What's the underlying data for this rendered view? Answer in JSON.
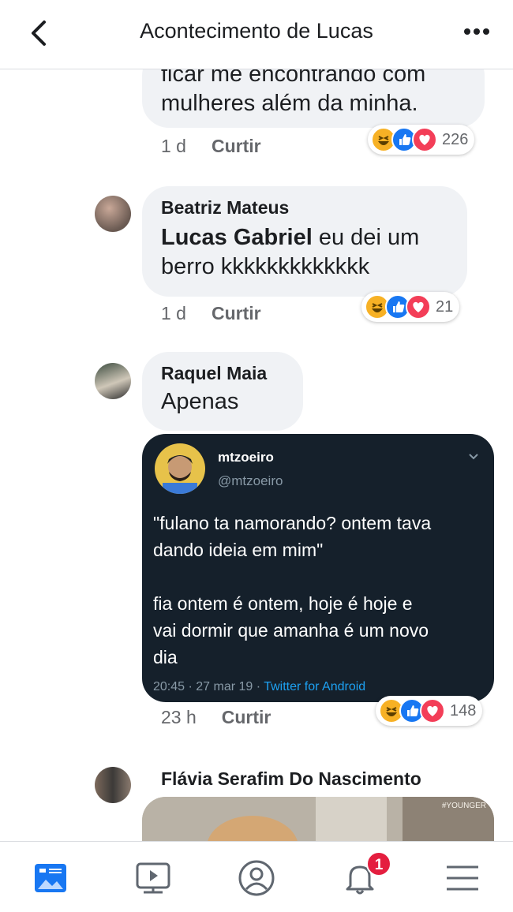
{
  "header": {
    "title": "Acontecimento de Lucas"
  },
  "comments": [
    {
      "text": "mulheres além da minha.",
      "partial_line": "ficar me encontrando com",
      "time": "1 d",
      "like_label": "Curtir",
      "reaction_count": "226"
    },
    {
      "author": "Beatriz Mateus",
      "mention": "Lucas Gabriel",
      "text_line1": " eu dei um",
      "text_line2": "berro kkkkkkkkkkkkk",
      "time": "1 d",
      "like_label": "Curtir",
      "reaction_count": "21"
    },
    {
      "author": "Raquel Maia",
      "text": "Apenas",
      "time": "23 h",
      "like_label": "Curtir",
      "reaction_count": "148",
      "tweet": {
        "name": "mtzoeiro",
        "handle": "@mtzoeiro",
        "line1": "\"fulano ta namorando? ontem tava",
        "line2": "dando ideia em mim\"",
        "line3": "fia ontem é ontem, hoje é hoje e",
        "line4": "vai dormir que amanha é um novo",
        "line5": "dia",
        "timestamp": "20:45 · 27 mar 19 · ",
        "source": "Twitter for Android"
      }
    },
    {
      "author": "Flávia Serafim Do Nascimento"
    }
  ],
  "video_watermark": "#YOUNGER",
  "reactions": [
    "haha",
    "like",
    "love"
  ],
  "nav": {
    "items": [
      "news-feed-icon",
      "watch-icon",
      "profile-icon",
      "notifications-icon",
      "menu-icon"
    ],
    "notification_count": "1"
  },
  "colors": {
    "facebook_blue": "#1877f2",
    "love_red": "#f33e58",
    "haha_yellow": "#f7b125",
    "twitter_bg": "#15202b"
  }
}
